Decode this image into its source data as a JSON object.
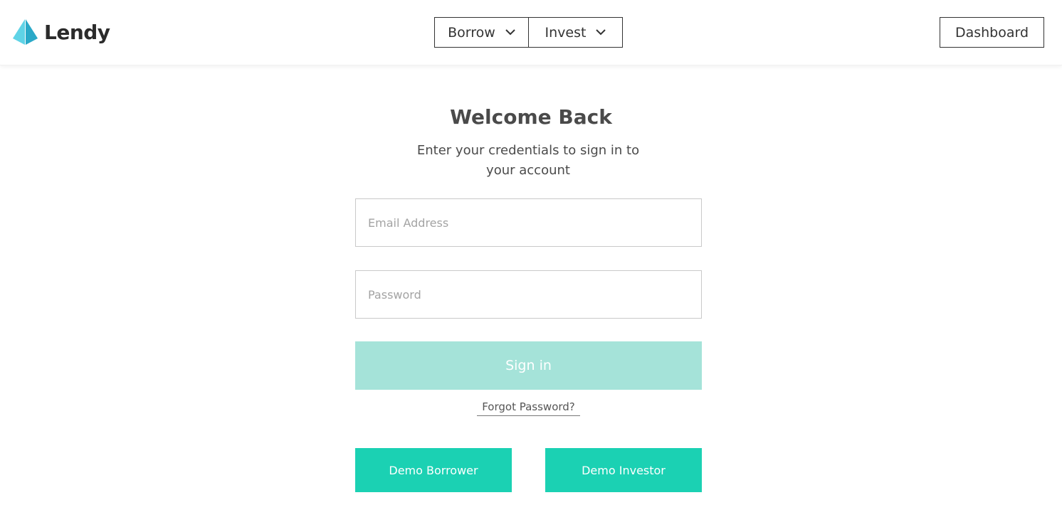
{
  "brand": {
    "name": "Lendy",
    "colors": {
      "logo_light": "#5fd3e6",
      "logo_dark": "#2aa9c8",
      "accent": "#1bd1b3",
      "accent_disabled": "#a5e3d9"
    }
  },
  "nav": {
    "borrow_label": "Borrow",
    "invest_label": "Invest",
    "dashboard_label": "Dashboard",
    "dropdown_icon": "chevron-down-icon"
  },
  "login": {
    "title": "Welcome Back",
    "subtitle": "Enter your credentials to sign in to your account",
    "email_placeholder": "Email Address",
    "email_value": "",
    "password_placeholder": "Password",
    "password_value": "",
    "signin_label": "Sign in",
    "forgot_label": "Forgot Password?",
    "demo_borrower_label": "Demo Borrower",
    "demo_investor_label": "Demo Investor"
  }
}
